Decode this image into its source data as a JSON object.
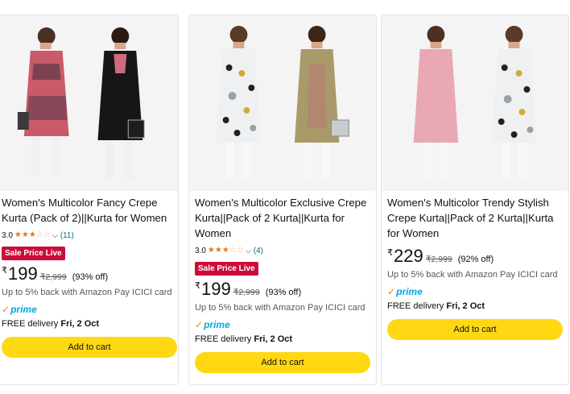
{
  "products": [
    {
      "title": "Women's Multicolor Fancy Crepe Kurta (Pack of 2)||Kurta for Women",
      "rating": "3.0",
      "stars": 3,
      "review_count": "(11)",
      "badge": "Sale Price Live",
      "currency": "₹",
      "price": "199",
      "mrp": "₹2,999",
      "discount": "(93% off)",
      "cashback": "Up to 5% back with Amazon Pay ICICI card",
      "prime": "prime",
      "delivery_label": "FREE delivery",
      "delivery_date": "Fri, 2 Oct",
      "button": "Add to cart"
    },
    {
      "title": "Women's Multicolor Exclusive Crepe Kurta||Pack of 2 Kurta||Kurta for Women",
      "rating": "3.0",
      "stars": 3,
      "review_count": "(4)",
      "badge": "Sale Price Live",
      "currency": "₹",
      "price": "199",
      "mrp": "₹2,999",
      "discount": "(93% off)",
      "cashback": "Up to 5% back with Amazon Pay ICICI card",
      "prime": "prime",
      "delivery_label": "FREE delivery",
      "delivery_date": "Fri, 2 Oct",
      "button": "Add to cart"
    },
    {
      "title": "Women's Multicolor Trendy Stylish Crepe Kurta||Pack of 2 Kurta||Kurta for Women",
      "currency": "₹",
      "price": "229",
      "mrp": "₹2,999",
      "discount": "(92% off)",
      "cashback": "Up to 5% back with Amazon Pay ICICI card",
      "prime": "prime",
      "delivery_label": "FREE delivery",
      "delivery_date": "Fri, 2 Oct",
      "button": "Add to cart"
    }
  ],
  "colors": {
    "badge": "#cc0c39",
    "button": "#ffd814",
    "star": "#de7921",
    "link": "#007185",
    "prime_blue": "#00a8e1",
    "prime_check": "#f08804"
  },
  "icons": {
    "star": "star-icon",
    "chevron": "chevron-down-icon",
    "prime_check": "prime-check-icon"
  }
}
